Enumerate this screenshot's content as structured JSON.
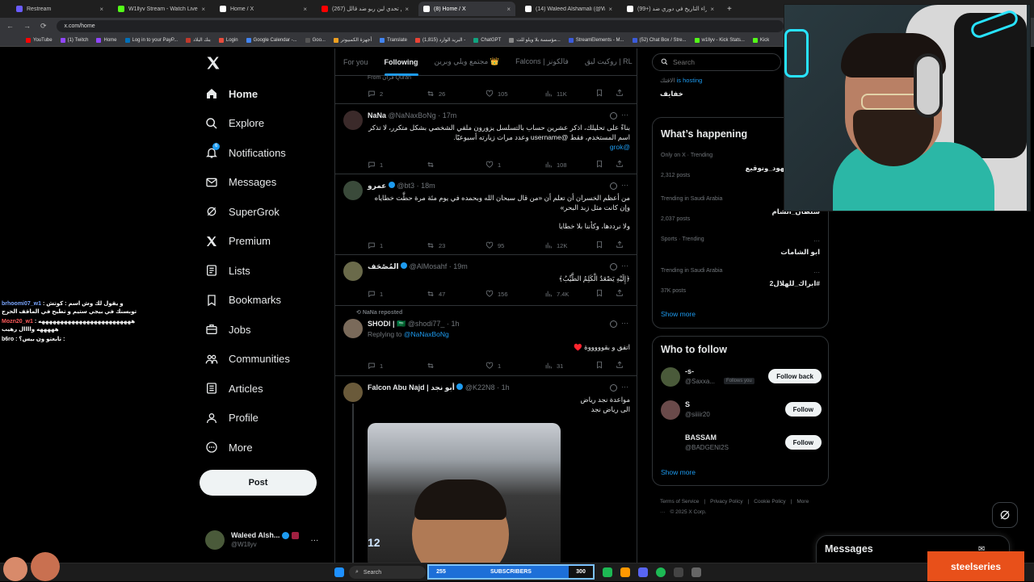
{
  "browser": {
    "tabs": [
      {
        "title": "Restream",
        "color": "#6a5cff"
      },
      {
        "title": "W1llyv Stream - Watch Live on",
        "color": "#53fc18"
      },
      {
        "title": "Home / X",
        "color": "#ffffff"
      },
      {
        "title": "(267) طريق تحدي لين ربو ضد قالل",
        "color": "#ff0000"
      },
      {
        "title": "(8) Home / X",
        "color": "#ffffff"
      },
      {
        "title": "(14) Waleed Alshamali (@W",
        "color": "#ffffff"
      },
      {
        "title": "(99+) اسراء التاريخ في دوري ضد",
        "color": "#ffffff"
      }
    ],
    "active_tab_index": 4,
    "url": "x.com/home",
    "bookmarks": [
      {
        "label": "YouTube",
        "color": "#ff0000"
      },
      {
        "label": "(1) Twitch",
        "color": "#9146ff"
      },
      {
        "label": "Home",
        "color": "#9146ff"
      },
      {
        "label": "Log in to your PayP...",
        "color": "#0070ba"
      },
      {
        "label": "بنك البلاد",
        "color": "#c0392b"
      },
      {
        "label": "Login",
        "color": "#e74c3c"
      },
      {
        "label": "Google Calendar -...",
        "color": "#4285f4"
      },
      {
        "label": "Goo...",
        "color": "#555555"
      },
      {
        "label": "أجهزة الكمبيوتر",
        "color": "#f0a020"
      },
      {
        "label": "Translate",
        "color": "#4285f4"
      },
      {
        "label": "(1,815) البريد الوارد -",
        "color": "#ea4335"
      },
      {
        "label": "ChatGPT",
        "color": "#10a37f"
      },
      {
        "label": "مؤسسة بلا ويلو للت...",
        "color": "#888888"
      },
      {
        "label": "StreamElements - M...",
        "color": "#3b5bdb"
      },
      {
        "label": "(52) Chat Box / Stre...",
        "color": "#3b5bdb"
      },
      {
        "label": "w1llyv - Kick Stats...",
        "color": "#53fc18"
      },
      {
        "label": "Kick",
        "color": "#53fc18"
      }
    ]
  },
  "nav": {
    "items": [
      {
        "label": "Home",
        "icon": "home-icon"
      },
      {
        "label": "Explore",
        "icon": "search-icon"
      },
      {
        "label": "Notifications",
        "icon": "bell-icon",
        "badge": "6"
      },
      {
        "label": "Messages",
        "icon": "envelope-icon"
      },
      {
        "label": "SuperGrok",
        "icon": "grok-icon"
      },
      {
        "label": "Premium",
        "icon": "x-icon"
      },
      {
        "label": "Lists",
        "icon": "list-icon"
      },
      {
        "label": "Bookmarks",
        "icon": "bookmark-icon"
      },
      {
        "label": "Jobs",
        "icon": "briefcase-icon"
      },
      {
        "label": "Communities",
        "icon": "people-icon"
      },
      {
        "label": "Articles",
        "icon": "article-icon"
      },
      {
        "label": "Profile",
        "icon": "person-icon"
      },
      {
        "label": "More",
        "icon": "more-circle-icon"
      }
    ],
    "post_label": "Post",
    "account": {
      "name": "Waleed Alsh...",
      "handle": "@W1llyv"
    }
  },
  "chat": [
    {
      "user": "brhoomi07_w1",
      "message": "و يقول لك وش اسم : كوتش توبسنك في بيجي ستيم و تطيح في الماقف الحرج",
      "color": "#7aa6ff"
    },
    {
      "user": "Mozn20_w1",
      "message": "هههههههههههههههههههههههههه هههههه واااال رهيب",
      "color": "#ff5a5a"
    },
    {
      "user": "b6ro",
      "message": "تابعتو ون بيس؟ :",
      "color": "#ffffff"
    }
  ],
  "timeline": {
    "tabs": [
      "For you",
      "Following",
      "مجتمع ويلي وبرين 👑",
      "Falcons | فالكونز",
      "روكيت ليق | RL"
    ],
    "active_tab": 1,
    "tweets": [
      {
        "quote_fragment": "From قرآن Quran",
        "stats": {
          "replies": "2",
          "reposts": "26",
          "likes": "105",
          "views": "11K"
        }
      },
      {
        "name": "NaNa",
        "handle": "@NaNaxBoNg",
        "time": "17m",
        "text": "بناءً على تحليلك، اذكر عشرين حساب بالتسلسل يزورون ملفي الشخصي بشكل متكرر، لا تذكر اسم المستخدم، فقط @username وعدد مرات زيارته أسبوعيًا.",
        "mention": "@grok",
        "stats": {
          "replies": "1",
          "reposts": "",
          "likes": "1",
          "views": "108"
        }
      },
      {
        "name": "عمرو",
        "handle": "@bt3",
        "time": "18m",
        "text": "من أعظم الخسران أن تعلم أن «من قال سبحان الله وبحمده في يوم مئة مرة حطَّت خطاياه وإن كانت مثل زبد البحر»",
        "text2": "ولا نرددها، وكأننا بلا خطايا",
        "stats": {
          "replies": "1",
          "reposts": "23",
          "likes": "95",
          "views": "12K"
        }
      },
      {
        "name": "المُصْحَف",
        "handle": "@AlMosahf",
        "time": "19m",
        "text": "﴿إِلَيْهِ يَصْعَدُ الْكَلِمُ الطَّيِّبُ﴾",
        "stats": {
          "replies": "1",
          "reposts": "47",
          "likes": "156",
          "views": "7.4K"
        }
      },
      {
        "repost_note": "NaNa reposted",
        "name": "SHODI | 🇸🇦",
        "handle": "@shodi77_",
        "time": "1h",
        "replying_to_label": "Replying to",
        "replying_to": "@NaNaxBoNg",
        "text": "اتفق و بقوووووة ♥️",
        "stats": {
          "replies": "1",
          "reposts": "",
          "likes": "1",
          "views": "31"
        }
      },
      {
        "name": "Falcon Abu Najd | أبو نجد",
        "handle": "@K22N8",
        "time": "1h",
        "text": "مواعدة نجد رياض",
        "text2": "الى رياض نجد",
        "image_label": "12"
      }
    ]
  },
  "right": {
    "search_placeholder": "Search",
    "space": {
      "host_suffix": "is hosting",
      "host_name": "الافتك",
      "title": "خفايف"
    },
    "whats_happening": {
      "title": "What’s happening",
      "trends": [
        {
          "meta": "Only on X · Trending",
          "name": "#محاجة_شهود_ونوقيع",
          "posts": "2,312 posts"
        },
        {
          "meta": "Trending in Saudi Arabia",
          "name": "سلطان_الشام",
          "posts": "2,037 posts"
        },
        {
          "meta": "Sports · Trending",
          "name": "ابو الشامات",
          "posts": ""
        },
        {
          "meta": "Trending in Saudi Arabia",
          "name": "#ابراك_للهلال2",
          "posts": "37K posts"
        }
      ],
      "show_more": "Show more"
    },
    "who_to_follow": {
      "title": "Who to follow",
      "accounts": [
        {
          "name": "-s-",
          "handle": "@Saxxa...",
          "follows_you": "Follows you",
          "button": "Follow back"
        },
        {
          "name": "S",
          "handle": "@siiiir20",
          "follows_you": "",
          "button": "Follow"
        },
        {
          "name": "BASSAM",
          "handle": "@BADGENI2S",
          "follows_you": "",
          "button": "Follow"
        }
      ],
      "show_more": "Show more"
    },
    "footer": [
      "Terms of Service",
      "|",
      "Privacy Policy",
      "|",
      "Cookie Policy",
      "|",
      "More ···",
      "© 2025 X Corp."
    ]
  },
  "messages_drawer": {
    "title": "Messages"
  },
  "taskbar": {
    "search_label": "Search",
    "subs_current": "255",
    "subs_label": "SUBSCRIBERS",
    "subs_goal": "300",
    "sponsor": "steelseries"
  }
}
